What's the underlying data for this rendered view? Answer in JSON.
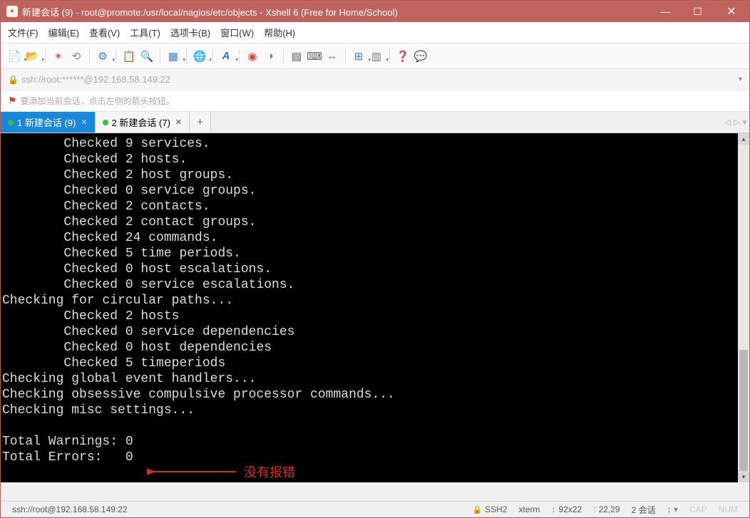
{
  "window": {
    "title": "新建会话 (9) - root@promote:/usr/local/nagios/etc/objects - Xshell 6 (Free for Home/School)"
  },
  "menu": {
    "items": [
      "文件(F)",
      "编辑(E)",
      "查看(V)",
      "工具(T)",
      "选项卡(B)",
      "窗口(W)",
      "帮助(H)"
    ]
  },
  "address": {
    "url": "ssh://root:******@192.168.58.149:22"
  },
  "hint": {
    "text": "要添加当前会话，点击左侧的箭头按钮。"
  },
  "tabs": {
    "items": [
      {
        "label": "1 新建会话 (9)",
        "active": true
      },
      {
        "label": "2 新建会话 (7)",
        "active": false
      }
    ]
  },
  "terminal": {
    "lines": [
      "        Checked 9 services.",
      "        Checked 2 hosts.",
      "        Checked 2 host groups.",
      "        Checked 0 service groups.",
      "        Checked 2 contacts.",
      "        Checked 2 contact groups.",
      "        Checked 24 commands.",
      "        Checked 5 time periods.",
      "        Checked 0 host escalations.",
      "        Checked 0 service escalations.",
      "Checking for circular paths...",
      "        Checked 2 hosts",
      "        Checked 0 service dependencies",
      "        Checked 0 host dependencies",
      "        Checked 5 timeperiods",
      "Checking global event handlers...",
      "Checking obsessive compulsive processor commands...",
      "Checking misc settings...",
      "",
      "Total Warnings: 0",
      "Total Errors:   0"
    ]
  },
  "annotation": {
    "text": "没有报错"
  },
  "status": {
    "path": "ssh://root@192.168.58.149:22",
    "proto": "SSH2",
    "term": "xterm",
    "size": "92x22",
    "cursor": "22,29",
    "sessions": "2 会话",
    "cap": "CAP",
    "num": "NUM"
  }
}
